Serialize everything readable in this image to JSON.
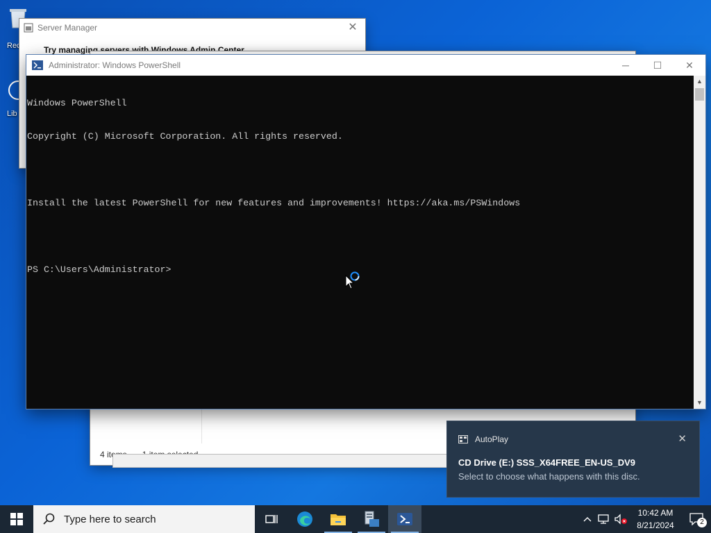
{
  "desktop": {
    "icons": [
      {
        "label": "Rec",
        "name": "recycle-bin-icon"
      },
      {
        "label": "Lib",
        "name": "library-icon"
      }
    ]
  },
  "server_manager": {
    "title": "Server Manager",
    "heading": "Try managing servers with Windows Admin Center"
  },
  "explorer": {
    "status_items": "4 items",
    "status_selected": "1 item selected"
  },
  "powershell": {
    "title": "Administrator: Windows PowerShell",
    "console_lines": [
      "Windows PowerShell",
      "Copyright (C) Microsoft Corporation. All rights reserved.",
      "",
      "Install the latest PowerShell for new features and improvements! https://aka.ms/PSWindows",
      "",
      "PS C:\\Users\\Administrator>"
    ],
    "controls": {
      "minimize": "─",
      "maximize": "☐",
      "close": "✕"
    }
  },
  "toast": {
    "app": "AutoPlay",
    "title": "CD Drive (E:) SSS_X64FREE_EN-US_DV9",
    "message": "Select to choose what happens with this disc.",
    "close": "✕"
  },
  "taskbar": {
    "search_placeholder": "Type here to search",
    "apps": [
      "task-view-icon",
      "edge-icon",
      "file-explorer-icon",
      "server-manager-icon",
      "powershell-icon"
    ],
    "active_app": "powershell-icon",
    "clock_time": "10:42 AM",
    "clock_date": "8/21/2024",
    "notification_count": "2"
  },
  "colors": {
    "desktop": "#0b63d6",
    "console_bg": "#0c0c0c",
    "console_fg": "#cccccc",
    "taskbar": "#1b2734",
    "toast_bg": "#26374a"
  }
}
